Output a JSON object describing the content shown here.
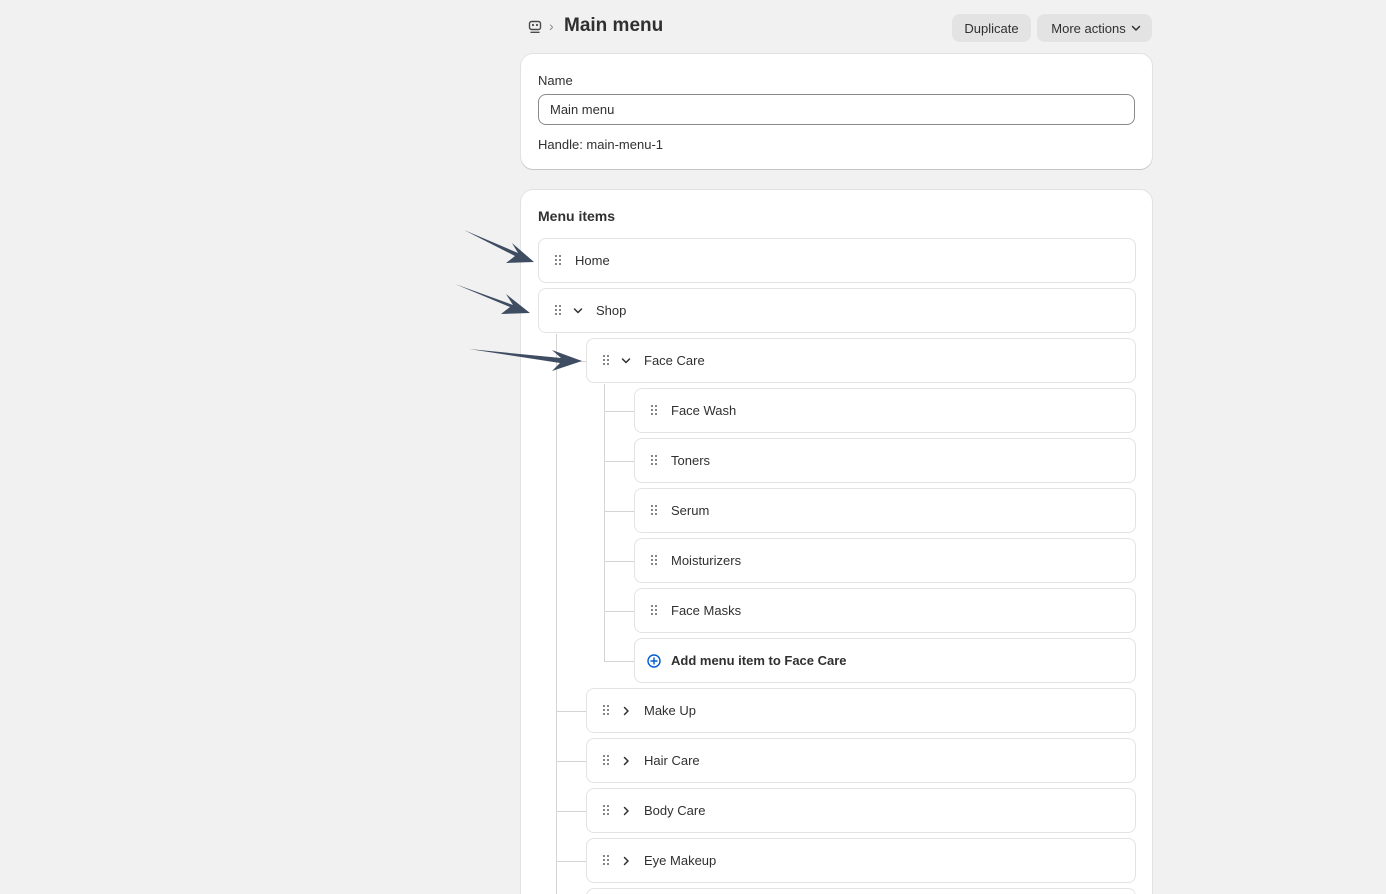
{
  "header": {
    "title": "Main menu",
    "duplicate_label": "Duplicate",
    "more_actions_label": "More actions"
  },
  "name_card": {
    "name_label": "Name",
    "name_value": "Main menu",
    "handle_text": "Handle: main-menu-1"
  },
  "menu_items": {
    "title": "Menu items",
    "home": "Home",
    "shop": "Shop",
    "face_care": "Face Care",
    "face_wash": "Face Wash",
    "toners": "Toners",
    "serum": "Serum",
    "moisturizers": "Moisturizers",
    "face_masks": "Face Masks",
    "add_to_face_care": "Add menu item to Face Care",
    "make_up": "Make Up",
    "hair_care": "Hair Care",
    "body_care": "Body Care",
    "eye_makeup": "Eye Makeup"
  },
  "colors": {
    "accent": "#005bd3",
    "annotation_arrow": "#3f4d63"
  }
}
